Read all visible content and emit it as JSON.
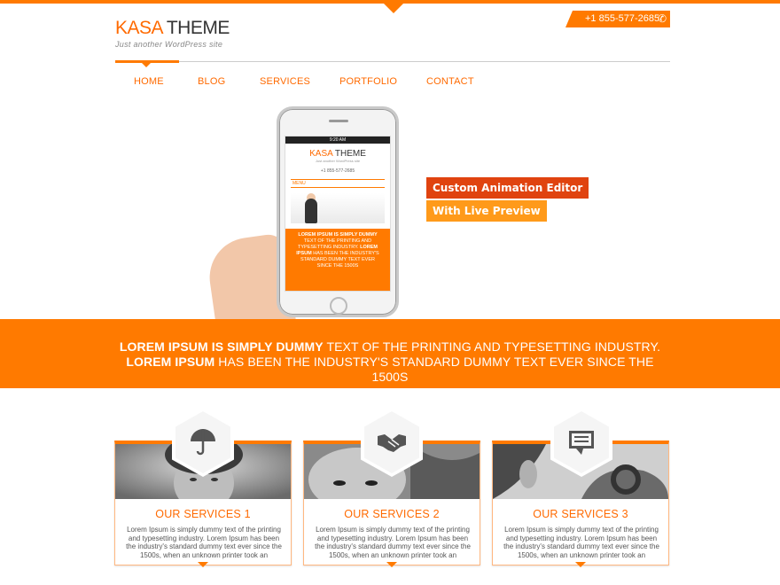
{
  "header": {
    "logo_kasa": "KASA",
    "logo_theme": " THEME",
    "tagline": "Just another WordPress site",
    "phone": "+1 855-577-2685"
  },
  "nav": {
    "items": [
      "HOME",
      "BLOG",
      "SERVICES",
      "PORTFOLIO",
      "CONTACT"
    ],
    "active": "HOME"
  },
  "hero": {
    "badge1": "Custom Animation Editor",
    "badge2": "With Live Preview",
    "phone_screen": {
      "status_time": "9:20 AM",
      "logo_kasa": "KASA",
      "logo_theme": " THEME",
      "tagline": "Just another WordPress site",
      "phone": "+1 855-577-2685",
      "menu": "MENU",
      "text_bold1": "LOREM IPSUM IS SIMPLY DUMMY",
      "text_normal1": " TEXT OF THE PRINTING AND TYPESETTING INDUSTRY. ",
      "text_bold2": "LOREM IPSUM",
      "text_normal2": " HAS BEEN THE INDUSTRY'S STANDARD DUMMY TEXT EVER SINCE THE 1500S"
    }
  },
  "banner": {
    "bold1": "LOREM IPSUM IS SIMPLY DUMMY",
    "normal1": " TEXT OF THE PRINTING AND TYPESETTING INDUSTRY. ",
    "bold2": "LOREM IPSUM",
    "normal2": " HAS BEEN THE INDUSTRY'S STANDARD DUMMY TEXT EVER SINCE THE 1500S"
  },
  "services": [
    {
      "title": "OUR SERVICES 1",
      "icon": "umbrella-icon",
      "desc": "Lorem Ipsum is simply dummy text of the printing and typesetting industry. Lorem Ipsum has been the industry's standard dummy text ever since the 1500s, when an unknown printer took an"
    },
    {
      "title": "OUR SERVICES 2",
      "icon": "handshake-icon",
      "desc": "Lorem Ipsum is simply dummy text of the printing and typesetting industry. Lorem Ipsum has been the industry's standard dummy text ever since the 1500s, when an unknown printer took an"
    },
    {
      "title": "OUR SERVICES 3",
      "icon": "chat-icon",
      "desc": "Lorem Ipsum is simply dummy text of the printing and typesetting industry. Lorem Ipsum has been the industry's standard dummy text ever since the 1500s, when an unknown printer took an"
    }
  ],
  "colors": {
    "accent": "#ff7a00",
    "badge_red": "#e0430f",
    "badge_orange": "#ff9a1a"
  }
}
